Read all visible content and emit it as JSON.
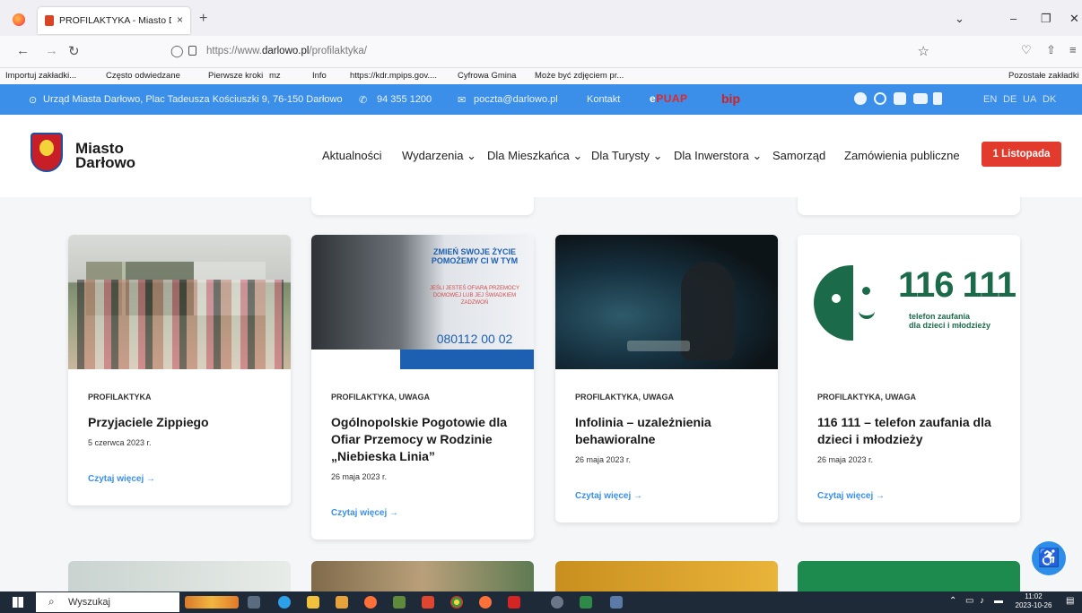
{
  "browser": {
    "tab_title": "PROFILAKTYKA - Miasto Darłowo",
    "tab_close": "×",
    "new_tab": "+",
    "url_prefix": "https://www.",
    "url_domain": "darlowo.pl",
    "url_path": "/profilaktyka/",
    "bookmarks": [
      "Importuj zakładki...",
      "Często odwiedzane",
      "Pierwsze kroki",
      "mz",
      "Info",
      "https://kdr.mpips.gov....",
      "Cyfrowa Gmina",
      "Może być zdjęciem pr...",
      "Pozostałe zakładki"
    ]
  },
  "topbar": {
    "address": "Urząd Miasta Darłowo, Plac Tadeusza Kościuszki 9, 76-150 Darłowo",
    "phone": "94 355 1200",
    "email": "poczta@darlowo.pl",
    "contact": "Kontakt",
    "epuap_prefix": "e",
    "epuap_main": "PUAP",
    "bip": "bip",
    "languages": [
      "EN",
      "DE",
      "UA",
      "DK"
    ]
  },
  "header": {
    "logo_line1": "Miasto",
    "logo_line2": "Darłowo",
    "menu": [
      "Aktualności",
      "Wydarzenia ⌄",
      "Dla Mieszkańca ⌄",
      "Dla Turysty ⌄",
      "Dla Inwerstora ⌄",
      "Samorząd",
      "Zamówienia publiczne"
    ],
    "cta": "1 Listopada"
  },
  "cards": [
    {
      "category": "PROFILAKTYKA",
      "title": "Przyjaciele Zippiego",
      "date": "5 czerwca 2023 r.",
      "more": "Czytaj więcej →"
    },
    {
      "category": "PROFILAKTYKA, UWAGA",
      "title": "Ogólnopolskie Pogotowie dla Ofiar Przemocy w Rodzinie „Niebieska Linia”",
      "date": "26 maja 2023 r.",
      "more": "Czytaj więcej →"
    },
    {
      "category": "PROFILAKTYKA, UWAGA",
      "title": "Infolinia – uzależnienia behawioralne",
      "date": "26 maja 2023 r.",
      "more": "Czytaj więcej →"
    },
    {
      "category": "PROFILAKTYKA, UWAGA",
      "title": "116 111 – telefon zaufania dla dzieci i młodzieży",
      "date": "26 maja 2023 r.",
      "more": "Czytaj więcej →"
    }
  ],
  "card_images": {
    "poster_headline": "ZMIEŃ SWOJE ŻYCIE POMOŻEMY CI W TYM",
    "poster_text": "JEŚLI JESTEŚ OFIARĄ PRZEMOCY DOMOWEJ LUB JEJ ŚWIADKIEM ZADZWOŃ",
    "poster_phone": "080112 00 02",
    "helpline_number": "116 111",
    "helpline_caption1": "telefon zaufania",
    "helpline_caption2": "dla dzieci i młodzieży"
  },
  "taskbar": {
    "search": "Wyszukaj",
    "time": "11:02",
    "date": "2023-10-26"
  }
}
